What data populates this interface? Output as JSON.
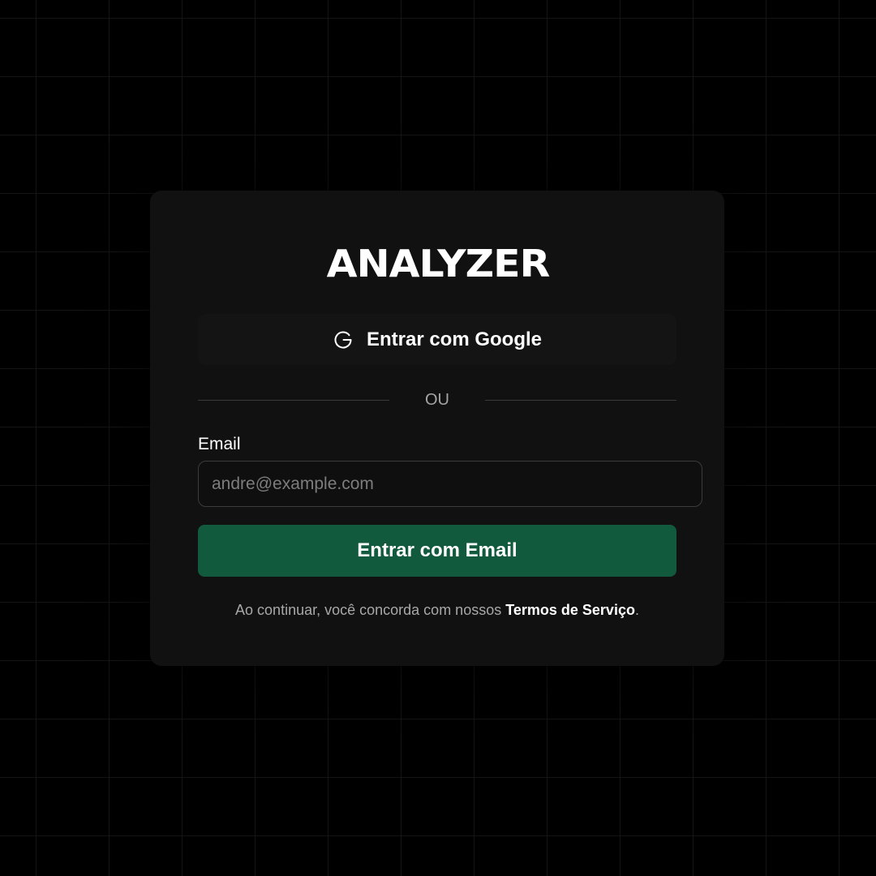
{
  "app": {
    "logo_text": "ANALYZER"
  },
  "auth": {
    "google_button_label": "Entrar com Google",
    "google_icon": "google-icon",
    "divider_text": "OU",
    "email_label": "Email",
    "email_placeholder": "andre@example.com",
    "email_value": "",
    "email_button_label": "Entrar com Email"
  },
  "terms": {
    "prefix": "Ao continuar, você concorda com nossos ",
    "link_text": "Termos de Serviço",
    "suffix": "."
  },
  "colors": {
    "background": "#000000",
    "card": "#111111",
    "primary_button": "#125a3e",
    "text": "#ffffff",
    "muted_text": "#a8a8a8"
  }
}
